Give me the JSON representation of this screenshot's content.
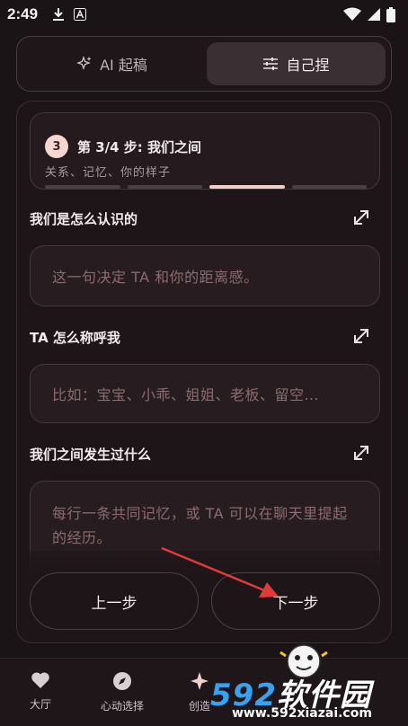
{
  "status_bar": {
    "time": "2:49"
  },
  "mode_toggle": {
    "ai_tab": "AI 起稿",
    "manual_tab": "自己捏"
  },
  "step": {
    "number": "3",
    "title": "第 3/4 步: 我们之间",
    "subtitle": "关系、记忆、你的样子",
    "total_steps": 4,
    "current_step": 3
  },
  "fields": [
    {
      "label": "我们是怎么认识的",
      "placeholder": "这一句决定 TA 和你的距离感。"
    },
    {
      "label": "TA 怎么称呼我",
      "placeholder": "比如：宝宝、小乖、姐姐、老板、留空…"
    },
    {
      "label": "我们之间发生过什么",
      "placeholder": "每行一条共同记忆，或 TA 可以在聊天里提起的经历。"
    }
  ],
  "buttons": {
    "prev": "上一步",
    "next": "下一步"
  },
  "bottom_nav": [
    {
      "label": "大厅"
    },
    {
      "label": "心动选择"
    },
    {
      "label": "创造"
    }
  ],
  "watermark": {
    "brand_num": "592",
    "brand_text": "软件园",
    "url": "www.592xiazai.com"
  },
  "colors": {
    "accent": "#f0cfc8",
    "arrow": "#e03a3a",
    "placeholder": "#8c6a71"
  }
}
